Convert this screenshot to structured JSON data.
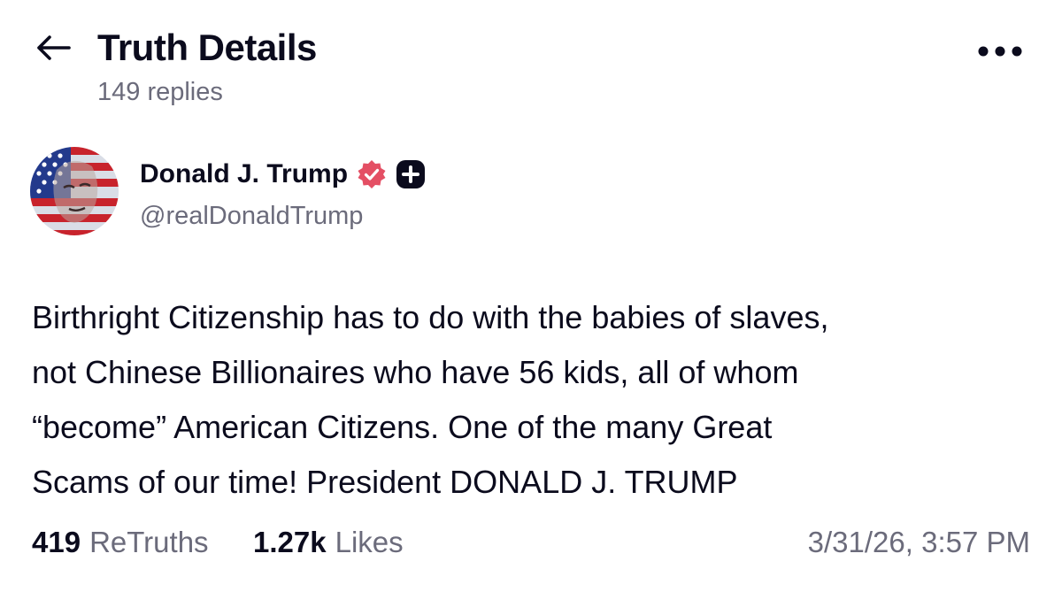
{
  "header": {
    "title": "Truth Details",
    "replies": "149 replies"
  },
  "author": {
    "name": "Donald J. Trump",
    "handle": "@realDonaldTrump",
    "verified_color": "#e44f64"
  },
  "post": {
    "lines": [
      "Birthright Citizenship has to do with the babies of slaves,",
      "not Chinese Billionaires who have 56 kids, all of whom",
      "“become” American Citizens. One of the many Great",
      "Scams of our time! President DONALD J. TRUMP"
    ]
  },
  "stats": {
    "retruths_count": "419",
    "retruths_label": "ReTruths",
    "likes_count": "1.27k",
    "likes_label": "Likes",
    "timestamp": "3/31/26, 3:57 PM"
  }
}
